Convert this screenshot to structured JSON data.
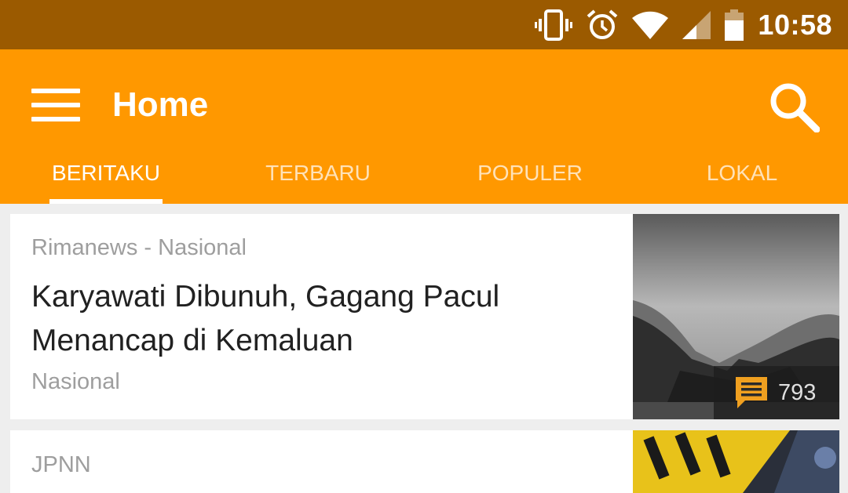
{
  "status_bar": {
    "time": "10:58",
    "icons": [
      "vibrate-icon",
      "alarm-icon",
      "wifi-icon",
      "signal-icon",
      "battery-icon"
    ]
  },
  "app_bar": {
    "title": "Home",
    "menu_icon": "hamburger-menu-icon",
    "search_icon": "search-icon",
    "colors": {
      "primary": "#ff9800",
      "status_bar": "#9b5a00",
      "text": "#ffffff"
    }
  },
  "tabs": [
    {
      "label": "BERITAKU",
      "active": true
    },
    {
      "label": "TERBARU",
      "active": false
    },
    {
      "label": "POPULER",
      "active": false
    },
    {
      "label": "LOKAL",
      "active": false
    }
  ],
  "articles": [
    {
      "source": "Rimanews - Nasional",
      "title": "Karyawati Dibunuh, Gagang Pacul Menancap di Kemaluan",
      "category": "Nasional",
      "comment_count": "793",
      "comment_icon": "comment-icon"
    },
    {
      "source": "JPNN"
    }
  ]
}
